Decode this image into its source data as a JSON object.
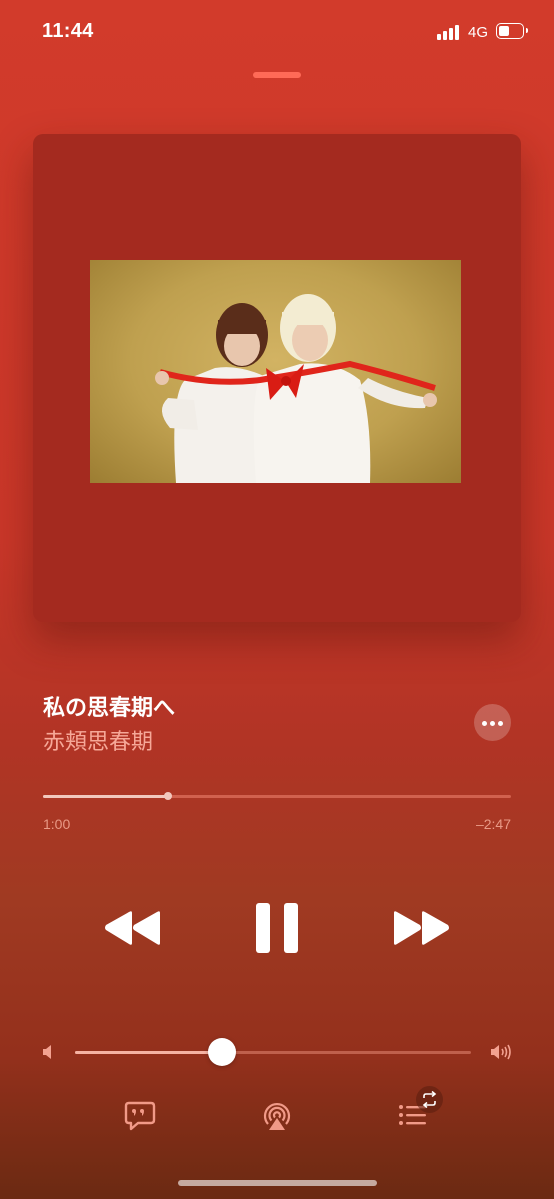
{
  "status_bar": {
    "time": "11:44",
    "network": "4G"
  },
  "now_playing": {
    "title": "私の思春期へ",
    "artist": "赤頬思春期",
    "elapsed": "1:00",
    "remaining": "–2:47",
    "progress_fraction": 0.267,
    "volume_fraction": 0.37
  },
  "icons": {
    "signal": "signal-bars-icon",
    "battery": "battery-icon",
    "more": "ellipsis-icon",
    "rewind": "rewind-icon",
    "pause": "pause-icon",
    "forward": "fast-forward-icon",
    "volume_low": "speaker-low-icon",
    "volume_high": "speaker-high-icon",
    "lyrics": "lyrics-quote-icon",
    "airplay": "airplay-icon",
    "queue": "queue-list-icon",
    "repeat": "repeat-icon"
  },
  "colors": {
    "background_top": "#d23b2b",
    "background_bottom": "#6b2a12",
    "artwork_bg": "#a42a1f",
    "accent_text": "#f6a898"
  }
}
